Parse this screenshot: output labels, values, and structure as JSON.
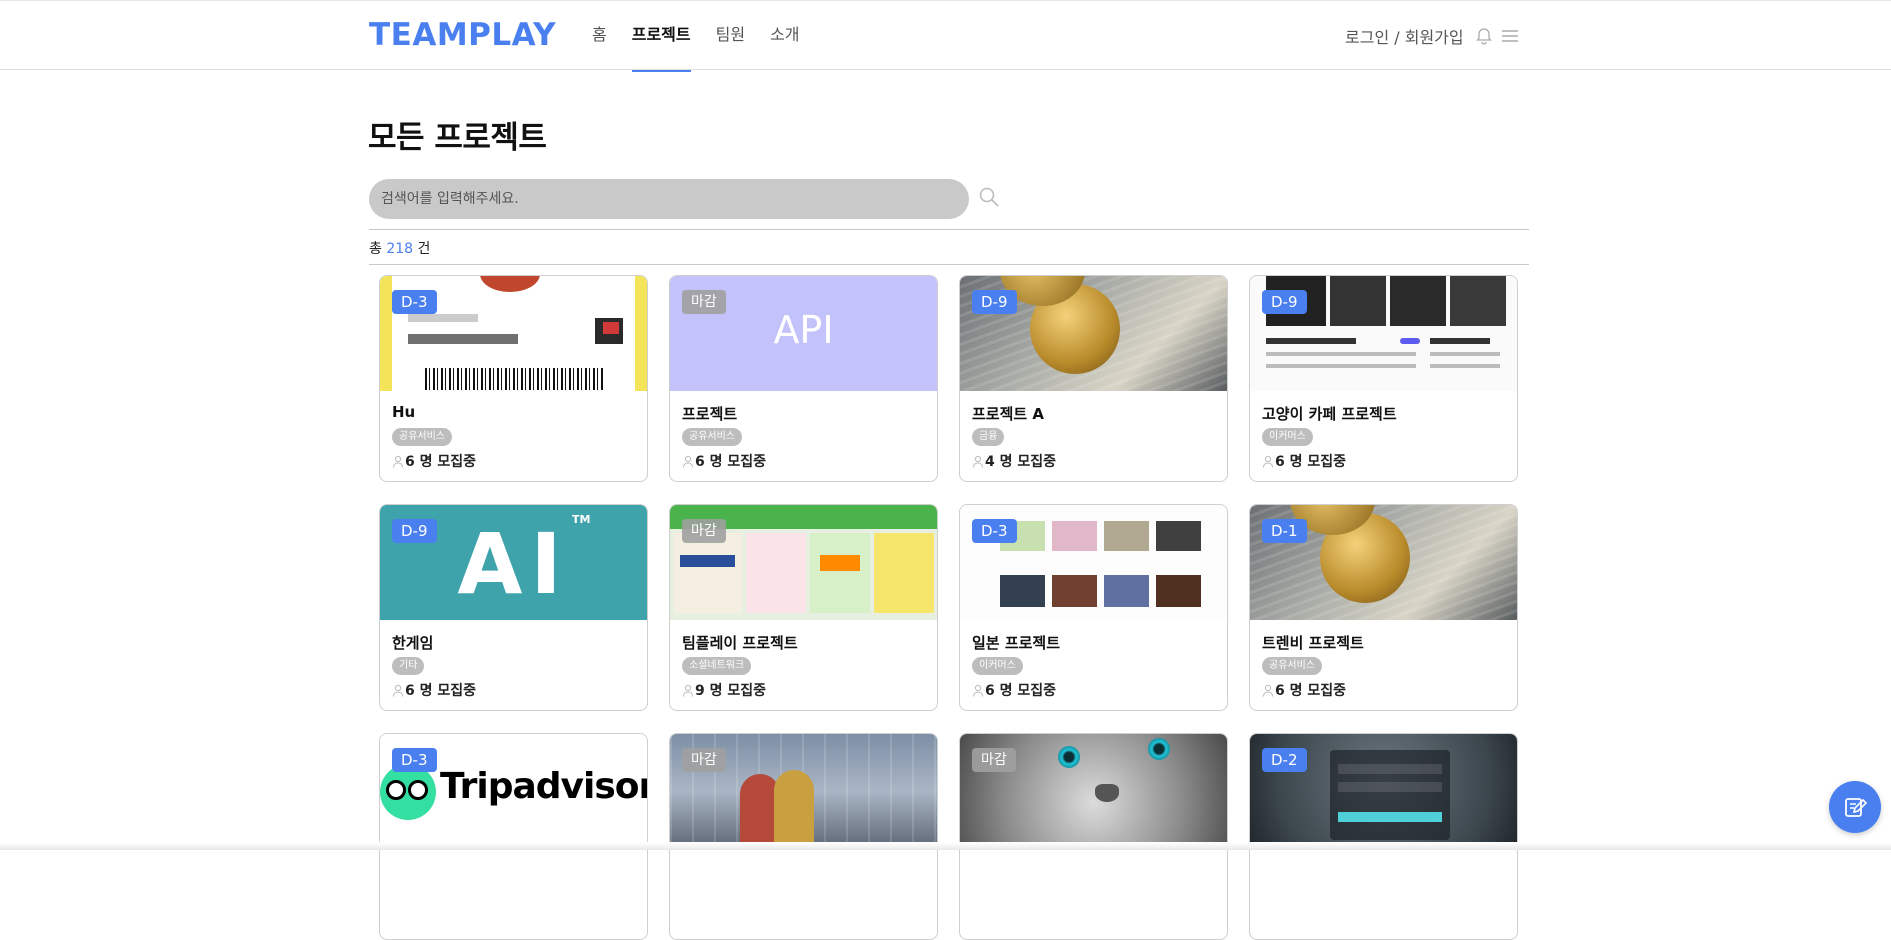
{
  "header": {
    "logo": "TEAMPLAY",
    "nav": [
      "홈",
      "프로젝트",
      "팀원",
      "소개"
    ],
    "active_nav": "프로젝트",
    "auth_link": "로그인 / 회원가입",
    "icons": [
      "bell-icon",
      "menu-icon"
    ]
  },
  "page": {
    "title": "모든 프로젝트",
    "search_placeholder": "검색어를 입력해주세요.",
    "count_prefix": "총",
    "count_value": "218",
    "count_suffix": "건"
  },
  "cards": [
    {
      "badge": "D-3",
      "title": "Hu",
      "tag": "공유서비스",
      "count": "6",
      "thumb": "latte-receipt"
    },
    {
      "badge": "마감",
      "title": "프로젝트",
      "tag": "공유서비스",
      "count": "6",
      "thumb": "api",
      "thumb_text": "API"
    },
    {
      "badge": "D-9",
      "title": "프로젝트 A",
      "tag": "금융",
      "count": "4",
      "thumb": "bitcoin"
    },
    {
      "badge": "D-9",
      "title": "고양이 카페 프로젝트",
      "tag": "이커머스",
      "count": "6",
      "thumb": "website"
    },
    {
      "badge": "D-9",
      "title": "한게임",
      "tag": "기타",
      "count": "6",
      "thumb": "ai-logo",
      "thumb_text": "AI",
      "thumb_mark": "TM"
    },
    {
      "badge": "마감",
      "title": "팀플레이 프로젝트",
      "tag": "소셜네트워크",
      "count": "9",
      "thumb": "posters"
    },
    {
      "badge": "D-3",
      "title": "일본 프로젝트",
      "tag": "이커머스",
      "count": "6",
      "thumb": "game-grid"
    },
    {
      "badge": "D-1",
      "title": "트렌비 프로젝트",
      "tag": "공유서비스",
      "count": "6",
      "thumb": "bitcoin"
    },
    {
      "badge": "D-3",
      "title": "",
      "tag": "",
      "count": "",
      "thumb": "tripadvisor",
      "thumb_text": "Tripadvisor"
    },
    {
      "badge": "마감",
      "title": "",
      "tag": "",
      "count": "",
      "thumb": "girls"
    },
    {
      "badge": "마감",
      "title": "",
      "tag": "",
      "count": "",
      "thumb": "cat"
    },
    {
      "badge": "D-2",
      "title": "",
      "tag": "",
      "count": "",
      "thumb": "login-dark"
    }
  ],
  "recruit_suffix": "명 모집중",
  "colors": {
    "accent": "#4a7ff0",
    "closed_badge": "#a0a0a0",
    "tag": "#bdbdbd"
  },
  "fab_icon": "edit-icon"
}
